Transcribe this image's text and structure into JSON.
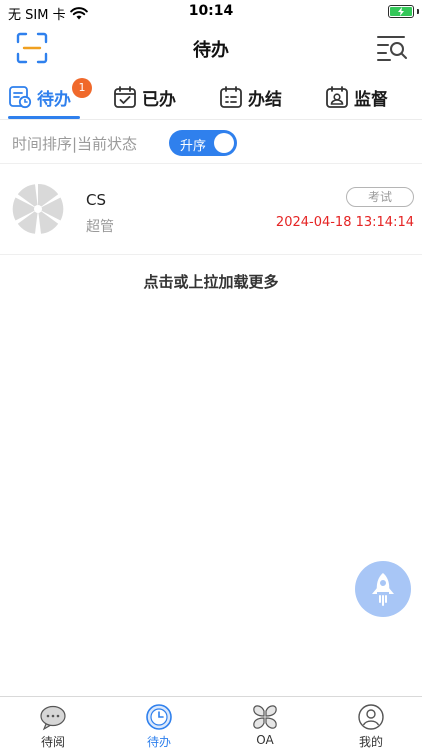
{
  "status_bar": {
    "carrier": "无 SIM 卡",
    "time": "10:14",
    "battery_color": "#34c759"
  },
  "header": {
    "title": "待办",
    "left_icon": "scan-icon",
    "right_icon": "list-search-icon"
  },
  "tabs": [
    {
      "label": "待办",
      "icon": "todo-clock-icon",
      "badge": "1",
      "active": true
    },
    {
      "label": "已办",
      "icon": "calendar-check-icon",
      "active": false
    },
    {
      "label": "办结",
      "icon": "calendar-list-icon",
      "active": false
    },
    {
      "label": "监督",
      "icon": "supervise-icon",
      "active": false
    }
  ],
  "sort_bar": {
    "text": "时间排序|当前状态",
    "toggle_label": "升序",
    "toggle_on": true
  },
  "items": [
    {
      "name": "CS",
      "role": "超管",
      "tag": "考试",
      "time": "2024-04-18 13:14:14",
      "avatar_icon": "placeholder-avatar-icon"
    }
  ],
  "load_more": "点击或上拉加载更多",
  "floating_button_icon": "rocket-icon",
  "bottom_nav": [
    {
      "label": "待阅",
      "icon": "chat-bubble-icon",
      "active": false
    },
    {
      "label": "待办",
      "icon": "clock-icon",
      "active": true
    },
    {
      "label": "OA",
      "icon": "clover-icon",
      "active": false
    },
    {
      "label": "我的",
      "icon": "user-icon",
      "active": false
    }
  ],
  "colors": {
    "accent": "#2f80ed",
    "badge": "#f0692b",
    "time_red": "#e52424"
  }
}
